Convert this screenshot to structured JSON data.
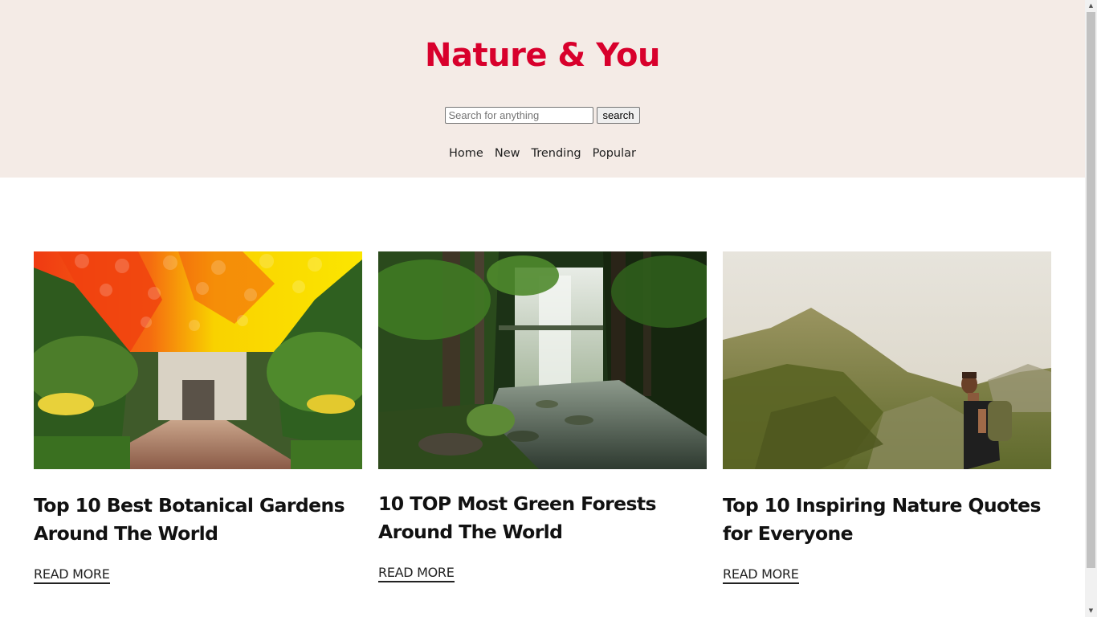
{
  "header": {
    "title": "Nature & You",
    "search": {
      "placeholder": "Search for anything",
      "value": "",
      "button_label": "search"
    },
    "nav": [
      {
        "label": "Home"
      },
      {
        "label": "New"
      },
      {
        "label": "Trending"
      },
      {
        "label": "Popular"
      }
    ]
  },
  "posts": [
    {
      "title": "Top 10 Best Botanical Gardens Around The World",
      "link_label": "READ MORE",
      "image": "botanical-garden-umbrella-canopy"
    },
    {
      "title": "10 TOP Most Green Forests Around The World",
      "link_label": "READ MORE",
      "image": "forest-waterfall-stream"
    },
    {
      "title": "Top 10 Inspiring Nature Quotes for Everyone",
      "link_label": "READ MORE",
      "image": "hiker-mountain"
    }
  ],
  "colors": {
    "header_bg": "#f4ebe6",
    "title": "#d8002c",
    "text": "#111111"
  }
}
